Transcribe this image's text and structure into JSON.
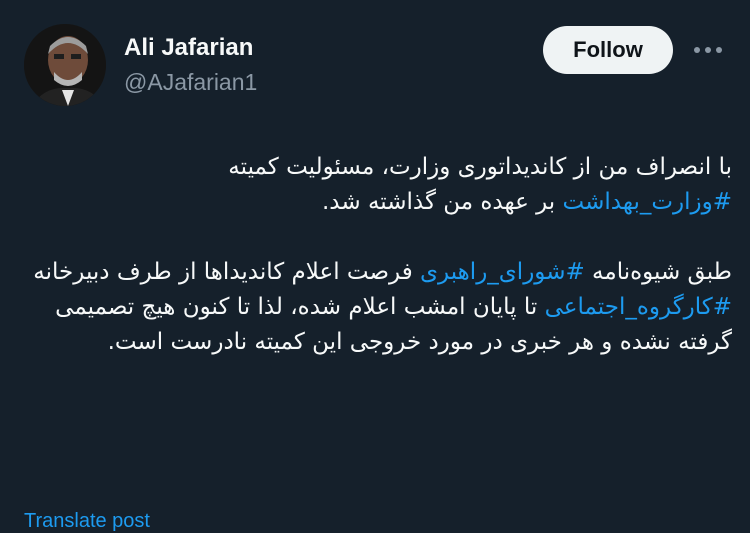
{
  "author": {
    "name": "Ali Jafarian",
    "handle": "@AJafarian1"
  },
  "actions": {
    "follow_label": "Follow",
    "more_icon": "more-horizontal-icon"
  },
  "tweet": {
    "p1_text1": "با انصراف من از کاندیداتوری وزارت، مسئولیت کمیته",
    "p1_tag1": "#وزارت_بهداشت",
    "p1_text2": " بر عهده من گذاشته شد.",
    "p2_text1": "طبق شیوه‌نامه ",
    "p2_tag1": "#شورای_راهبری",
    "p2_text2": " فرصت اعلام کاندیداها از طرف دبیرخانه ",
    "p2_tag2": "#کارگروه_اجتماعی",
    "p2_text3": " تا پایان امشب اعلام شده، لذا تا کنون هیچ تصمیمی گرفته نشده و هر خبری در مورد خروجی این کمیته نادرست است."
  },
  "translate_link": "Translate post",
  "colors": {
    "background": "#15202b",
    "accent": "#1d9bf0",
    "text": "#f7f9f9",
    "secondary": "#8b98a5",
    "follow_bg": "#eff3f4"
  }
}
